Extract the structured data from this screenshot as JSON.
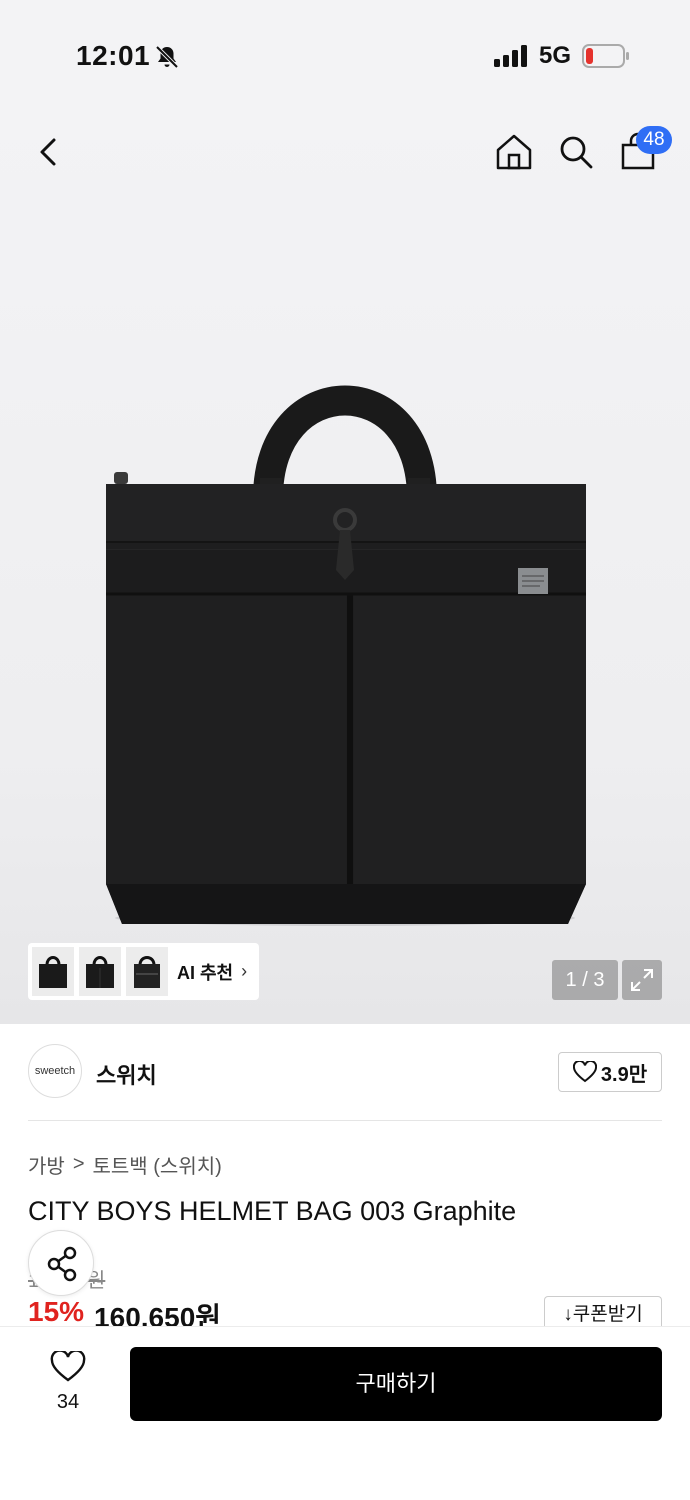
{
  "status_bar": {
    "time": "12:01",
    "network": "5G",
    "icons": [
      "bell-slash-icon",
      "signal-icon",
      "battery-low-icon"
    ],
    "battery_color": "#e5322d"
  },
  "nav": {
    "cart_count": "48",
    "icons": [
      "back-icon",
      "home-icon",
      "search-icon",
      "shopping-bag-icon"
    ],
    "badge_color": "#2f6ef5"
  },
  "gallery": {
    "ai_label": "AI 추천",
    "ai_chevron": "›",
    "page_counter": "1 / 3"
  },
  "brand": {
    "logo_text": "sweetch",
    "name": "스위치",
    "like_count": "3.9만"
  },
  "product": {
    "breadcrumb": [
      "가방",
      "토트백 (스위치)"
    ],
    "breadcrumb_sep": ">",
    "title": "CITY BOYS HELMET BAG 003 Graphite",
    "original_price": "1··,·00원",
    "discount": "15%",
    "sale_price": "160,650원",
    "discount_color": "#e0231f"
  },
  "actions": {
    "coupon_label": "↓쿠폰받기",
    "wish_count": "34",
    "buy_label": "구매하기"
  }
}
